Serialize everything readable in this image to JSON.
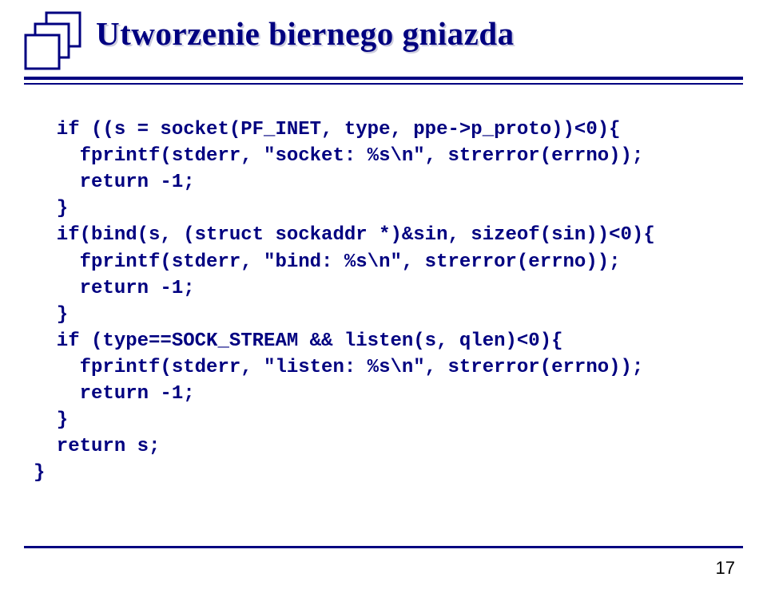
{
  "title": "Utworzenie biernego gniazda",
  "code": "  if ((s = socket(PF_INET, type, ppe->p_proto))<0){\n    fprintf(stderr, \"socket: %s\\n\", strerror(errno));\n    return -1;\n  }\n  if(bind(s, (struct sockaddr *)&sin, sizeof(sin))<0){\n    fprintf(stderr, \"bind: %s\\n\", strerror(errno));\n    return -1;\n  }\n  if (type==SOCK_STREAM && listen(s, qlen)<0){\n    fprintf(stderr, \"listen: %s\\n\", strerror(errno));\n    return -1;\n  }\n  return s;\n}",
  "page_number": "17"
}
